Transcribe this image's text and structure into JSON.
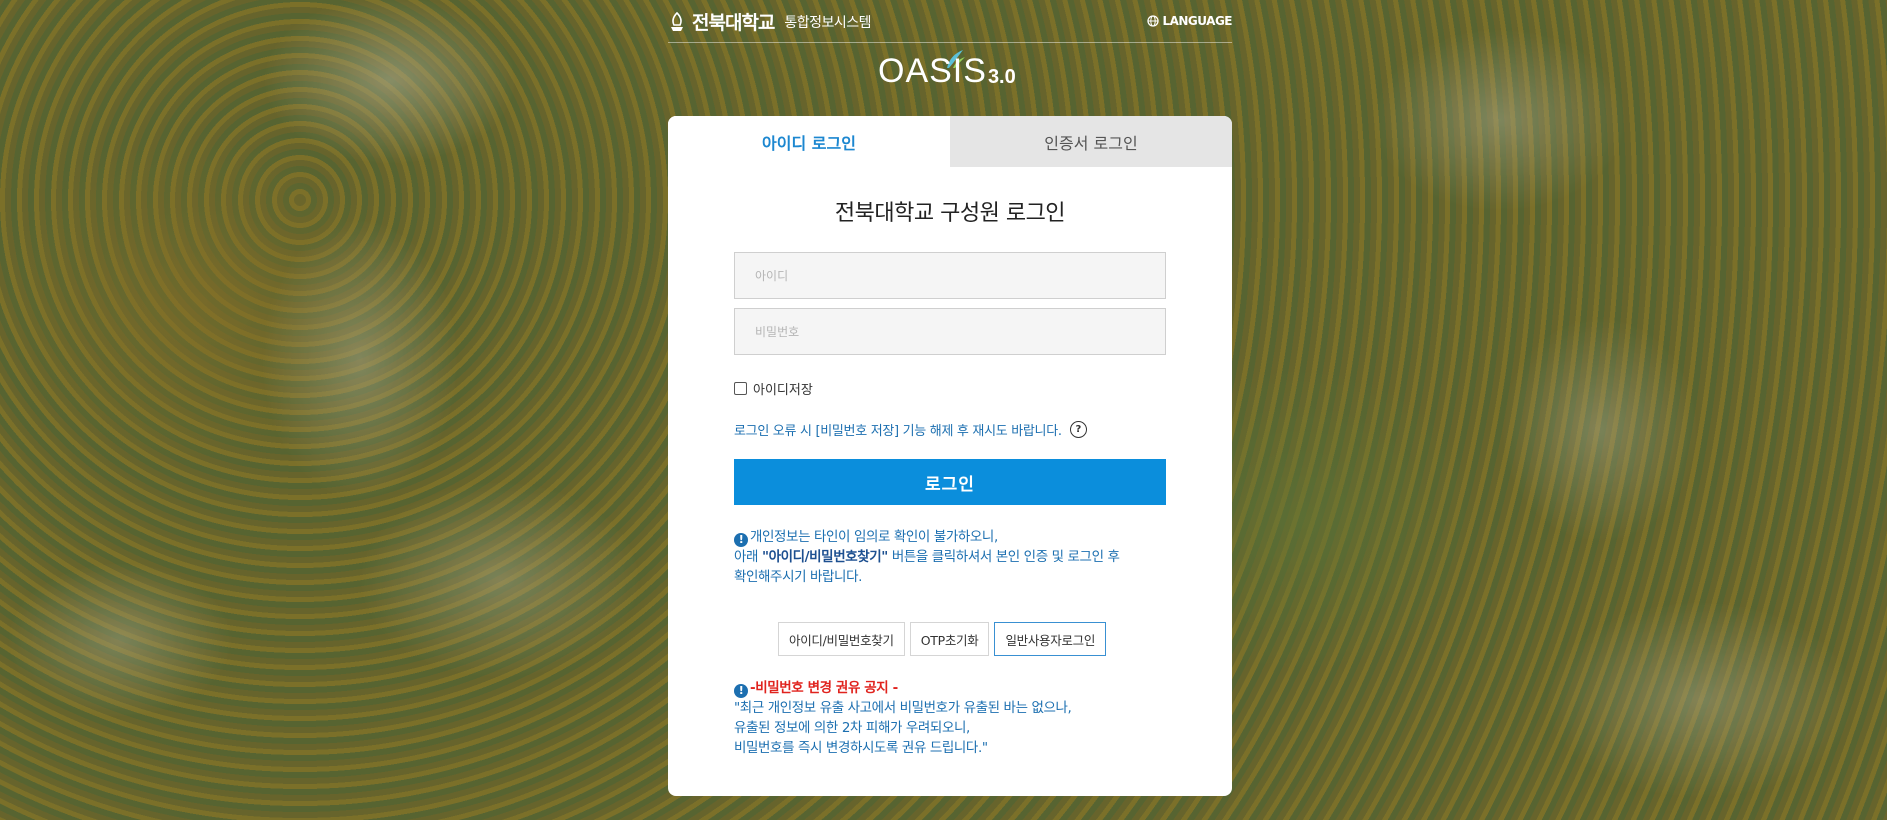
{
  "header": {
    "university": "전북대학교",
    "system_name": "통합정보시스템",
    "language_label": "LANGUAGE"
  },
  "logo": {
    "main": "OASIS",
    "version": "3.0"
  },
  "tabs": [
    {
      "label": "아이디 로그인",
      "active": true
    },
    {
      "label": "인증서 로그인",
      "active": false
    }
  ],
  "form": {
    "title": "전북대학교 구성원 로그인",
    "id_placeholder": "아이디",
    "password_placeholder": "비밀번호",
    "save_id_label": "아이디저장",
    "save_id_checked": false,
    "login_error_notice": "로그인 오류 시 [비밀번호 저장] 기능 해제 후 재시도 바랍니다.",
    "help_icon": "?",
    "login_button": "로그인"
  },
  "info": {
    "icon": "!",
    "line1": "개인정보는 타인이 임의로 확인이 불가하오니,",
    "line2_prefix": "아래 ",
    "line2_bold": "\"아이디/비밀번호찾기\"",
    "line2_suffix": " 버튼을 클릭하셔서 본인 인증 및 로그인 후",
    "line3": "확인해주시기 바랍니다."
  },
  "buttons": {
    "find_id_pw": "아이디/비밀번호찾기",
    "otp_reset": "OTP초기화",
    "general_login": "일반사용자로그인"
  },
  "warning": {
    "icon": "!",
    "title": "-비밀번호 변경 권유 공지 -",
    "line1": "\"최근 개인정보 유출 사고에서 비밀번호가 유출된 바는 없으나,",
    "line2": "유출된 정보에 의한 2차 피해가 우려되오니,",
    "line3": "비밀번호를 즉시 변경하시도록 권유 드립니다.\""
  },
  "colors": {
    "accent": "#0b8edc",
    "link_text": "#1c6fb0",
    "warning_red": "#e0231e"
  }
}
